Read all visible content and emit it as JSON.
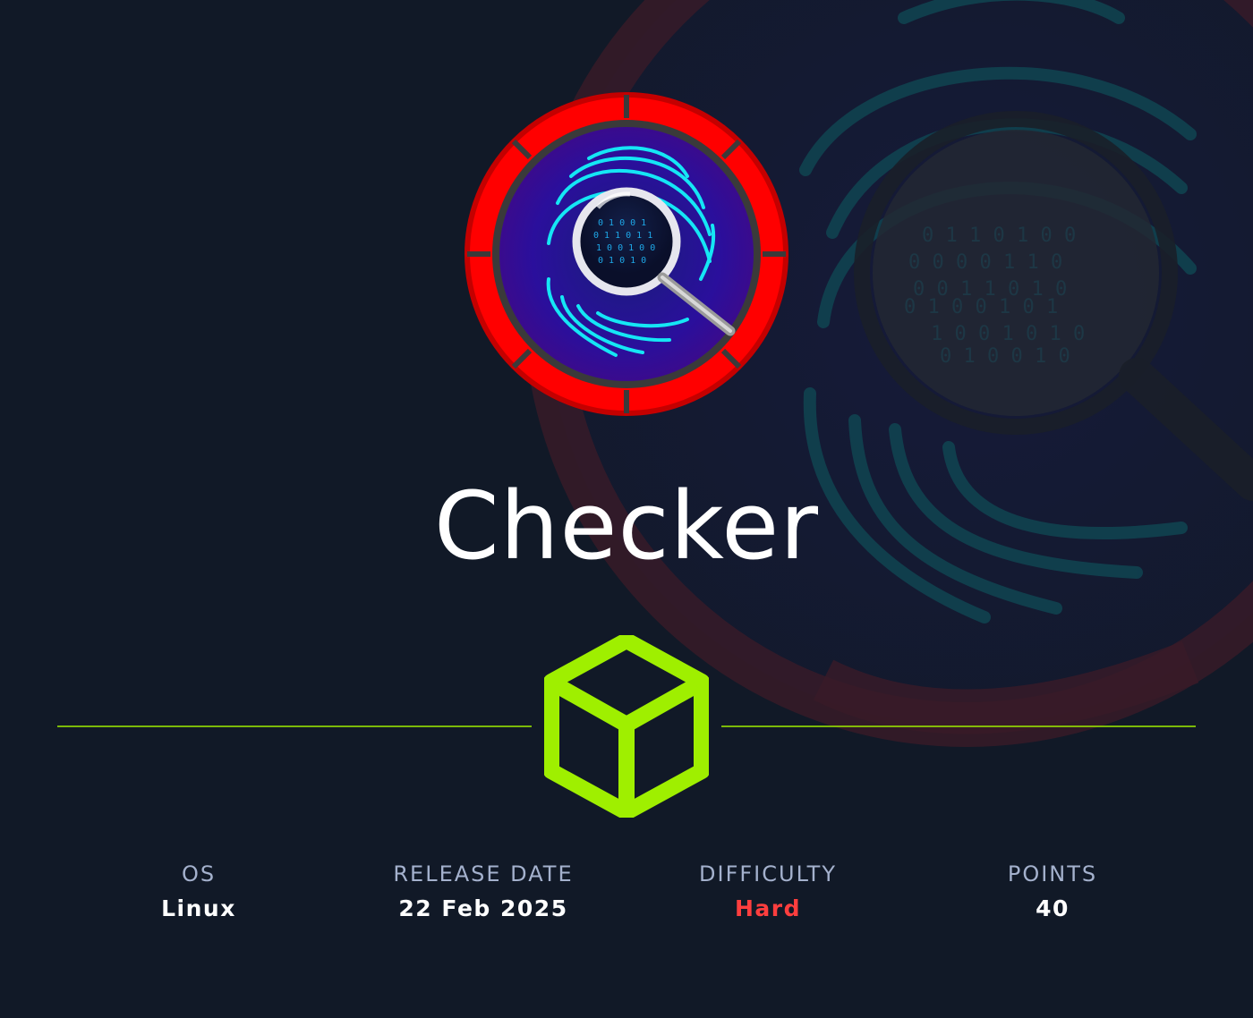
{
  "machine": {
    "name": "Checker",
    "avatar_icon": "fingerprint-magnifier-icon",
    "badge_icon": "cube-icon"
  },
  "stats": {
    "os": {
      "label": "OS",
      "value": "Linux"
    },
    "release_date": {
      "label": "RELEASE DATE",
      "value": "22 Feb 2025"
    },
    "difficulty": {
      "label": "DIFFICULTY",
      "value": "Hard"
    },
    "points": {
      "label": "POINTS",
      "value": "40"
    }
  },
  "colors": {
    "background": "#111927",
    "accent_green": "#9fef00",
    "difficulty_hard": "#ff3e3e",
    "label": "#a4b1cd",
    "avatar_ring": "#ff0000",
    "fingerprint": "#15e6f5"
  }
}
